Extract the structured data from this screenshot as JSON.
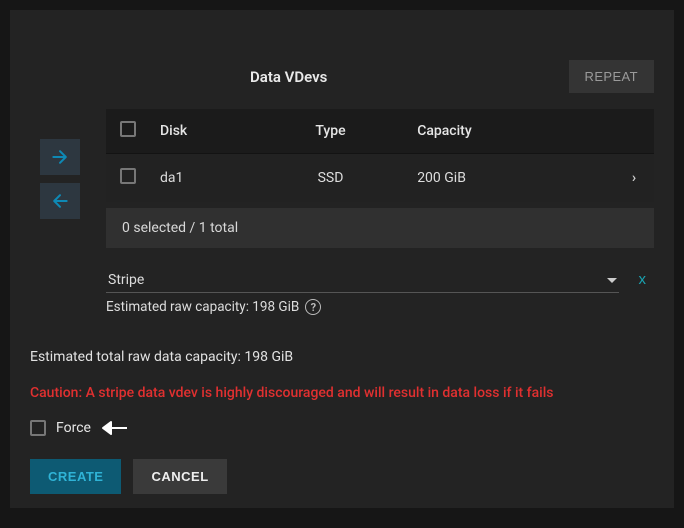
{
  "header": {
    "title": "Data VDevs",
    "repeat": "REPEAT"
  },
  "table": {
    "columns": {
      "disk": "Disk",
      "type": "Type",
      "capacity": "Capacity"
    },
    "rows": [
      {
        "disk": "da1",
        "type": "SSD",
        "capacity": "200 GiB"
      }
    ],
    "selection": "0 selected / 1 total"
  },
  "layout": {
    "select_value": "Stripe",
    "remove": "x",
    "est_raw_label": "Estimated raw capacity: 198 GiB"
  },
  "summary": {
    "total": "Estimated total raw data capacity: 198 GiB",
    "caution": "Caution: A stripe data vdev is highly discouraged and will result in data loss if it fails"
  },
  "force": {
    "label": "Force"
  },
  "buttons": {
    "create": "CREATE",
    "cancel": "CANCEL"
  }
}
